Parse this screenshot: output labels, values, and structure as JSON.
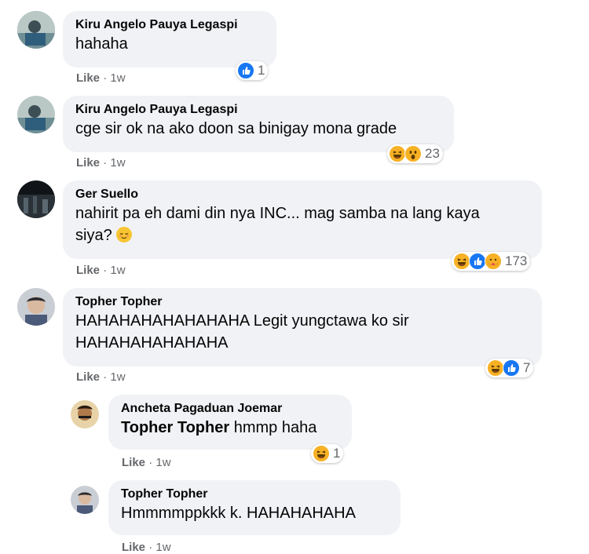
{
  "comments": [
    {
      "author": "Kiru Angelo Pauya Legaspi",
      "text": "hahaha",
      "like_label": "Like",
      "sep": "·",
      "time": "1w",
      "reaction_count": "1",
      "reactions": [
        "like"
      ]
    },
    {
      "author": "Kiru Angelo Pauya Legaspi",
      "text": "cge sir ok na ako doon sa binigay mona grade",
      "like_label": "Like",
      "sep": "·",
      "time": "1w",
      "reaction_count": "23",
      "reactions": [
        "haha",
        "wow"
      ]
    },
    {
      "author": "Ger Suello",
      "text_line1": "nahirit pa eh dami din nya INC... mag samba na lang kaya",
      "text_line2": "siya?",
      "inline_emoji": "relieved-face-emoji",
      "like_label": "Like",
      "sep": "·",
      "time": "1w",
      "reaction_count": "173",
      "reactions": [
        "haha",
        "like",
        "care"
      ]
    },
    {
      "author": "Topher Topher",
      "text_line1": "HAHAHAHAHAHAHAHA Legit yungctawa ko sir",
      "text_line2": "HAHAHAHAHAHAHA",
      "like_label": "Like",
      "sep": "·",
      "time": "1w",
      "reaction_count": "7",
      "reactions": [
        "haha",
        "like"
      ]
    }
  ],
  "replies": [
    {
      "author": "Ancheta Pagaduan Joemar",
      "mention": "Topher Topher",
      "text": " hmmp haha",
      "like_label": "Like",
      "sep": "·",
      "time": "1w",
      "reaction_count": "1",
      "reactions": [
        "haha"
      ]
    },
    {
      "author": "Topher Topher",
      "text": "Hmmmmppkkk k. HAHAHAHAHA",
      "like_label": "Like",
      "sep": "·",
      "time": "1w"
    }
  ],
  "colors": {
    "bubble": "#f0f2f5",
    "meta": "#65676b",
    "like_blue": "#1877f2",
    "haha_yellow": "#f7b125"
  }
}
